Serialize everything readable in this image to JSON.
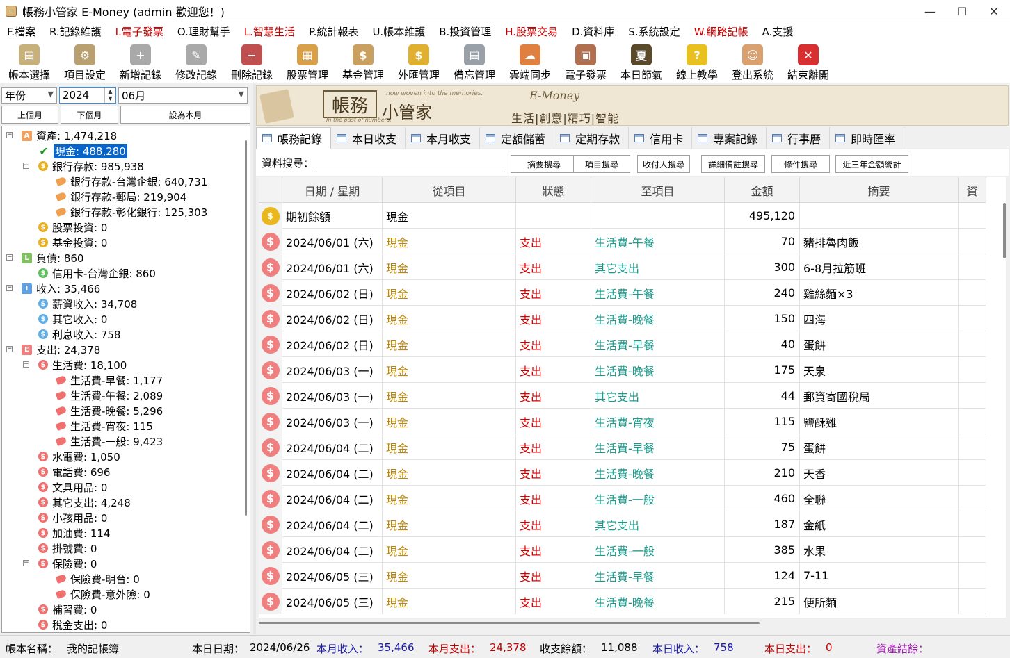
{
  "window": {
    "title": "帳務小管家 E-Money (admin 歡迎您！)",
    "minimize": "—",
    "maximize": "☐",
    "close": "✕"
  },
  "menu": [
    {
      "label": "F.檔案",
      "red": false
    },
    {
      "label": "R.記錄維護",
      "red": false
    },
    {
      "label": "I.電子發票",
      "red": true
    },
    {
      "label": "O.理財幫手",
      "red": false
    },
    {
      "label": "L.智慧生活",
      "red": true
    },
    {
      "label": "P.統計報表",
      "red": false
    },
    {
      "label": "U.帳本維護",
      "red": false
    },
    {
      "label": "B.投資管理",
      "red": false
    },
    {
      "label": "H.股票交易",
      "red": true
    },
    {
      "label": "D.資料庫",
      "red": false
    },
    {
      "label": "S.系統設定",
      "red": false
    },
    {
      "label": "W.網路記帳",
      "red": true
    },
    {
      "label": "A.支援",
      "red": false
    }
  ],
  "toolbar": [
    {
      "label": "帳本選擇",
      "icon": "ledger-icon",
      "color": "#c8b07a",
      "glyph": "▤"
    },
    {
      "label": "項目設定",
      "icon": "settings-icon",
      "color": "#b8a070",
      "glyph": "⚙"
    },
    {
      "label": "新增記錄",
      "icon": "add-record-icon",
      "color": "#a9a9a9",
      "glyph": "+"
    },
    {
      "label": "修改記錄",
      "icon": "edit-record-icon",
      "color": "#a9a9a9",
      "glyph": "✎"
    },
    {
      "label": "刪除記錄",
      "icon": "delete-record-icon",
      "color": "#c05050",
      "glyph": "−"
    },
    {
      "label": "股票管理",
      "icon": "stock-icon",
      "color": "#d9a04a",
      "glyph": "▦"
    },
    {
      "label": "基金管理",
      "icon": "fund-icon",
      "color": "#c9a060",
      "glyph": "$"
    },
    {
      "label": "外匯管理",
      "icon": "forex-icon",
      "color": "#e0b030",
      "glyph": "$"
    },
    {
      "label": "備忘管理",
      "icon": "memo-icon",
      "color": "#9aa0a8",
      "glyph": "▤"
    },
    {
      "label": "雲端同步",
      "icon": "cloud-sync-icon",
      "color": "#e08040",
      "glyph": "☁"
    },
    {
      "label": "電子發票",
      "icon": "qrcode-icon",
      "color": "#b07050",
      "glyph": "▣"
    },
    {
      "label": "本日節氣",
      "icon": "solar-term-icon",
      "color": "#5a4a2a",
      "glyph": "夏"
    },
    {
      "label": "線上教學",
      "icon": "help-icon",
      "color": "#e8c020",
      "glyph": "?"
    },
    {
      "label": "登出系統",
      "icon": "logout-icon",
      "color": "#d9a070",
      "glyph": "☺"
    },
    {
      "label": "結束離開",
      "icon": "exit-icon",
      "color": "#d83030",
      "glyph": "✕"
    }
  ],
  "filter": {
    "period_type": "年份",
    "year": "2024",
    "month": "06月",
    "prev_month": "上個月",
    "next_month": "下個月",
    "set_current": "設為本月"
  },
  "tree": [
    {
      "label": "資產: 1,474,218",
      "level": 0,
      "icon": "A",
      "color": "#f0a060",
      "expander": "−"
    },
    {
      "label": "現金: 488,280",
      "level": 1,
      "icon": "check",
      "color": "#1f9a1f",
      "selected": true
    },
    {
      "label": "銀行存款: 985,938",
      "level": 1,
      "icon": "$",
      "color": "#e8b020",
      "expander": "−"
    },
    {
      "label": "銀行存款-台灣企銀: 640,731",
      "level": 2,
      "icon": "tag",
      "color": "#f0a050"
    },
    {
      "label": "銀行存款-郵局: 219,904",
      "level": 2,
      "icon": "tag",
      "color": "#f0a050"
    },
    {
      "label": "銀行存款-彰化銀行: 125,303",
      "level": 2,
      "icon": "tag",
      "color": "#f0a050"
    },
    {
      "label": "股票投資: 0",
      "level": 1,
      "icon": "$",
      "color": "#e8b020"
    },
    {
      "label": "基金投資: 0",
      "level": 1,
      "icon": "$",
      "color": "#e8b020"
    },
    {
      "label": "負債: 860",
      "level": 0,
      "icon": "L",
      "color": "#80c060",
      "expander": "−"
    },
    {
      "label": "信用卡-台灣企銀: 860",
      "level": 1,
      "icon": "$",
      "color": "#60c060"
    },
    {
      "label": "收入: 35,466",
      "level": 0,
      "icon": "I",
      "color": "#60a0e0",
      "expander": "−"
    },
    {
      "label": "薪資收入: 34,708",
      "level": 1,
      "icon": "$",
      "color": "#60b0e8"
    },
    {
      "label": "其它收入: 0",
      "level": 1,
      "icon": "$",
      "color": "#60b0e8"
    },
    {
      "label": "利息收入: 758",
      "level": 1,
      "icon": "$",
      "color": "#60b0e8"
    },
    {
      "label": "支出: 24,378",
      "level": 0,
      "icon": "E",
      "color": "#f08080",
      "expander": "−"
    },
    {
      "label": "生活費: 18,100",
      "level": 1,
      "icon": "$",
      "color": "#f07070",
      "expander": "−"
    },
    {
      "label": "生活費-早餐: 1,177",
      "level": 2,
      "icon": "tag",
      "color": "#f07070"
    },
    {
      "label": "生活費-午餐: 2,089",
      "level": 2,
      "icon": "tag",
      "color": "#f07070"
    },
    {
      "label": "生活費-晚餐: 5,296",
      "level": 2,
      "icon": "tag",
      "color": "#f07070"
    },
    {
      "label": "生活費-宵夜: 115",
      "level": 2,
      "icon": "tag",
      "color": "#f07070"
    },
    {
      "label": "生活費-一般: 9,423",
      "level": 2,
      "icon": "tag",
      "color": "#f07070"
    },
    {
      "label": "水電費: 1,050",
      "level": 1,
      "icon": "$",
      "color": "#f07070"
    },
    {
      "label": "電話費: 696",
      "level": 1,
      "icon": "$",
      "color": "#f07070"
    },
    {
      "label": "文具用品: 0",
      "level": 1,
      "icon": "$",
      "color": "#f07070"
    },
    {
      "label": "其它支出: 4,248",
      "level": 1,
      "icon": "$",
      "color": "#f07070"
    },
    {
      "label": "小孩用品: 0",
      "level": 1,
      "icon": "$",
      "color": "#f07070"
    },
    {
      "label": "加油費: 114",
      "level": 1,
      "icon": "$",
      "color": "#f07070"
    },
    {
      "label": "掛號費: 0",
      "level": 1,
      "icon": "$",
      "color": "#f07070"
    },
    {
      "label": "保險費: 0",
      "level": 1,
      "icon": "$",
      "color": "#f07070",
      "expander": "−"
    },
    {
      "label": "保險費-明台: 0",
      "level": 2,
      "icon": "tag",
      "color": "#f07070"
    },
    {
      "label": "保險費-意外險: 0",
      "level": 2,
      "icon": "tag",
      "color": "#f07070"
    },
    {
      "label": "補習費: 0",
      "level": 1,
      "icon": "$",
      "color": "#f07070"
    },
    {
      "label": "稅金支出: 0",
      "level": 1,
      "icon": "$",
      "color": "#f07070"
    }
  ],
  "banner": {
    "title1": "帳務",
    "title2": "小管家",
    "small1": "now woven into the memories.",
    "small2": "In the past of numbers,",
    "emoney": "E-Money",
    "slogan": "生活|創意|精巧|智能"
  },
  "tabs": [
    "帳務記錄",
    "本日收支",
    "本月收支",
    "定額儲蓄",
    "定期存款",
    "信用卡",
    "專案記錄",
    "行事曆",
    "即時匯率"
  ],
  "search": {
    "label": "資料搜尋：",
    "value": "",
    "buttons": [
      "摘要搜尋",
      "項目搜尋",
      "收付人搜尋",
      "詳細備註搜尋",
      "條件搜尋",
      "近三年金額統計"
    ]
  },
  "grid": {
    "headers": [
      "日期 / 星期",
      "從項目",
      "狀態",
      "至項目",
      "金額",
      "摘要",
      "資"
    ],
    "opening": {
      "label": "期初餘額",
      "from": "現金",
      "amount": "495,120"
    },
    "rows": [
      {
        "date": "2024/06/01 (六)",
        "from": "現金",
        "status": "支出",
        "to": "生活費-午餐",
        "amount": "70",
        "memo": "豬排魯肉飯"
      },
      {
        "date": "2024/06/01 (六)",
        "from": "現金",
        "status": "支出",
        "to": "其它支出",
        "amount": "300",
        "memo": "6-8月拉筋班"
      },
      {
        "date": "2024/06/02 (日)",
        "from": "現金",
        "status": "支出",
        "to": "生活費-午餐",
        "amount": "240",
        "memo": "雞絲麵×3"
      },
      {
        "date": "2024/06/02 (日)",
        "from": "現金",
        "status": "支出",
        "to": "生活費-晚餐",
        "amount": "150",
        "memo": "四海"
      },
      {
        "date": "2024/06/02 (日)",
        "from": "現金",
        "status": "支出",
        "to": "生活費-早餐",
        "amount": "40",
        "memo": "蛋餅"
      },
      {
        "date": "2024/06/03 (一)",
        "from": "現金",
        "status": "支出",
        "to": "生活費-晚餐",
        "amount": "175",
        "memo": "天泉"
      },
      {
        "date": "2024/06/03 (一)",
        "from": "現金",
        "status": "支出",
        "to": "其它支出",
        "amount": "44",
        "memo": "郵資寄國稅局"
      },
      {
        "date": "2024/06/03 (一)",
        "from": "現金",
        "status": "支出",
        "to": "生活費-宵夜",
        "amount": "115",
        "memo": "鹽酥雞"
      },
      {
        "date": "2024/06/04 (二)",
        "from": "現金",
        "status": "支出",
        "to": "生活費-早餐",
        "amount": "75",
        "memo": "蛋餅"
      },
      {
        "date": "2024/06/04 (二)",
        "from": "現金",
        "status": "支出",
        "to": "生活費-晚餐",
        "amount": "210",
        "memo": "天香"
      },
      {
        "date": "2024/06/04 (二)",
        "from": "現金",
        "status": "支出",
        "to": "生活費-一般",
        "amount": "460",
        "memo": "全聯"
      },
      {
        "date": "2024/06/04 (二)",
        "from": "現金",
        "status": "支出",
        "to": "其它支出",
        "amount": "187",
        "memo": "金紙"
      },
      {
        "date": "2024/06/04 (二)",
        "from": "現金",
        "status": "支出",
        "to": "生活費-一般",
        "amount": "385",
        "memo": "水果"
      },
      {
        "date": "2024/06/05 (三)",
        "from": "現金",
        "status": "支出",
        "to": "生活費-早餐",
        "amount": "124",
        "memo": "7-11"
      },
      {
        "date": "2024/06/05 (三)",
        "from": "現金",
        "status": "支出",
        "to": "生活費-晚餐",
        "amount": "215",
        "memo": "便所麵"
      }
    ]
  },
  "status": {
    "book_label": "帳本名稱：",
    "book_name": "我的記帳簿",
    "today_label": "本日日期：",
    "today": "2024/06/26",
    "month_income_label": "本月收入：",
    "month_income": "35,466",
    "month_expense_label": "本月支出：",
    "month_expense": "24,378",
    "balance_label": "收支餘額：",
    "balance": "11,088",
    "day_income_label": "本日收入：",
    "day_income": "758",
    "day_expense_label": "本日支出：",
    "day_expense": "0",
    "assets_label": "資產結餘："
  }
}
